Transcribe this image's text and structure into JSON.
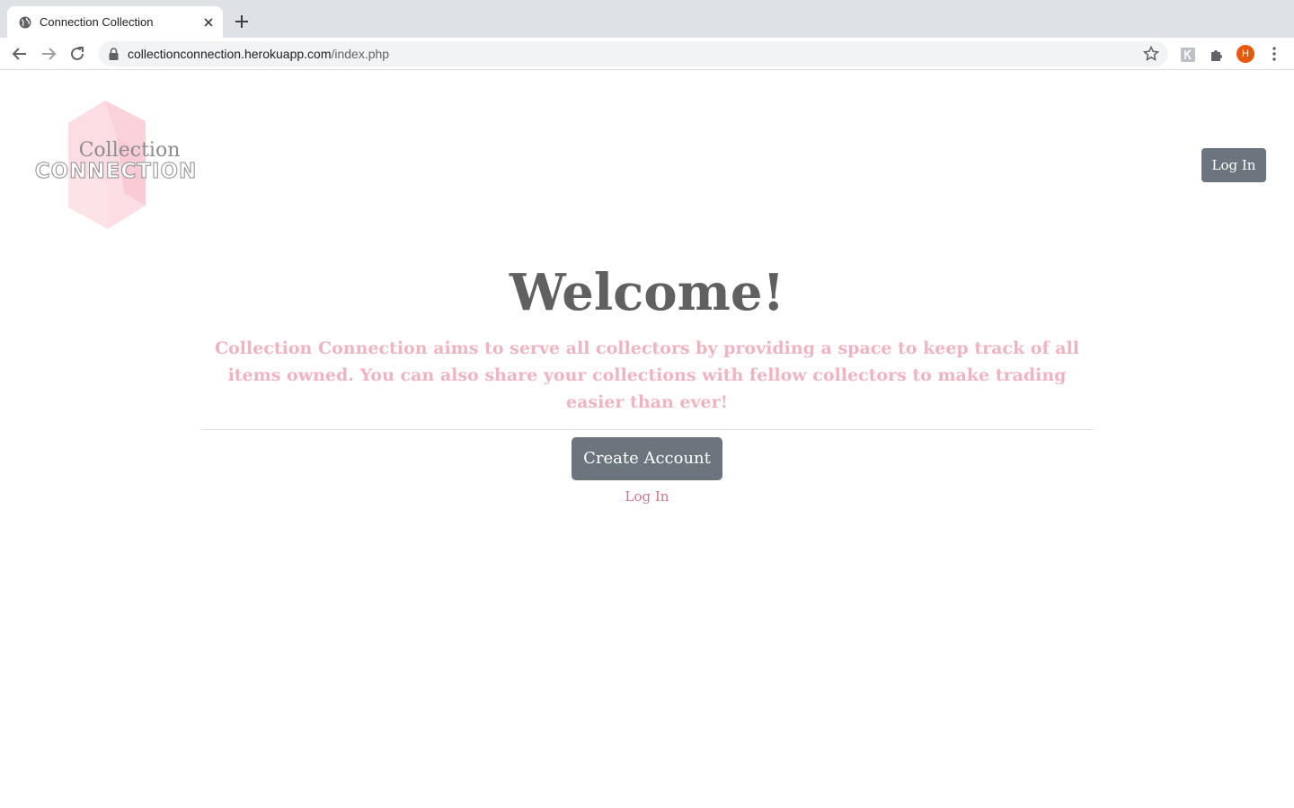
{
  "browser": {
    "tab_title": "Connection Collection",
    "url_host": "collectionconnection.herokuapp.com",
    "url_path": "/index.php",
    "profile_initial": "H"
  },
  "icons": {
    "favicon": "globe-icon",
    "tab_close": "close-icon",
    "new_tab": "plus-icon",
    "back": "back-arrow-icon",
    "forward": "forward-arrow-icon",
    "reload": "reload-icon",
    "lock": "lock-icon",
    "bookmark": "star-icon",
    "extension_1": "extension-app-icon",
    "extensions": "puzzle-icon",
    "menu": "kebab-menu-icon"
  },
  "header": {
    "logo_line_1": "Collection",
    "logo_line_2": "CONNECTION",
    "login_label": "Log In"
  },
  "main": {
    "heading": "Welcome!",
    "description": "Collection Connection aims to serve all collectors by providing a space to keep track of all items owned. You can also share your collections with fellow collectors to make trading easier than ever!",
    "create_account_label": "Create Account",
    "login_link_label": "Log In"
  },
  "colors": {
    "button_bg": "#6c757d",
    "heading": "#616060",
    "accent_pink": "#efb4c1",
    "link_pink": "#c97a8b",
    "logo_hex": "#fcdde3"
  }
}
